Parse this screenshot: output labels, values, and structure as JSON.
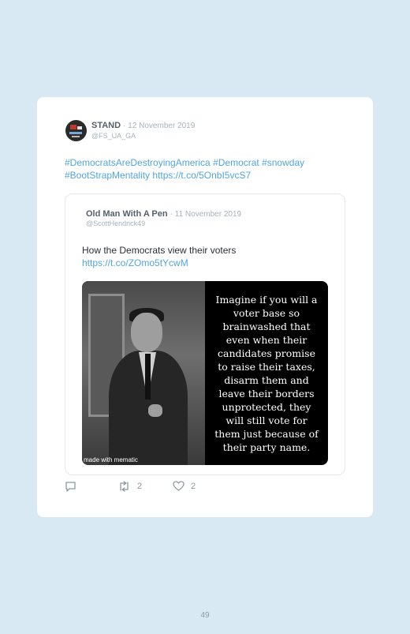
{
  "tweet": {
    "user_name": "STAND",
    "date": "· 12 November 2019",
    "handle": "@FS_UA_GA",
    "text_line1": "#DemocratsAreDestroyingAmerica #Democrat #snowday",
    "text_line2": "#BootStrapMentality https://t.co/5OnbI5vcS7"
  },
  "quoted": {
    "user_name": "Old Man With A Pen",
    "date": "· 11 November 2019",
    "handle": "@ScottHendrick49",
    "text": "How the Democrats view their voters",
    "link": "https://t.co/ZOmo5tYcwM",
    "media": {
      "caption": "Imagine if you will a voter base so brainwashed that even when their candidates promise to raise their taxes, disarm them and leave their borders unprotected, they will still vote for them just because of their party name.",
      "watermark": "made with mematic"
    }
  },
  "actions": {
    "retweets": "2",
    "likes": "2"
  },
  "page_number": "49",
  "colors": {
    "background": "#d9e9f4",
    "link": "#52a5dd",
    "muted": "#a7b2bd"
  }
}
